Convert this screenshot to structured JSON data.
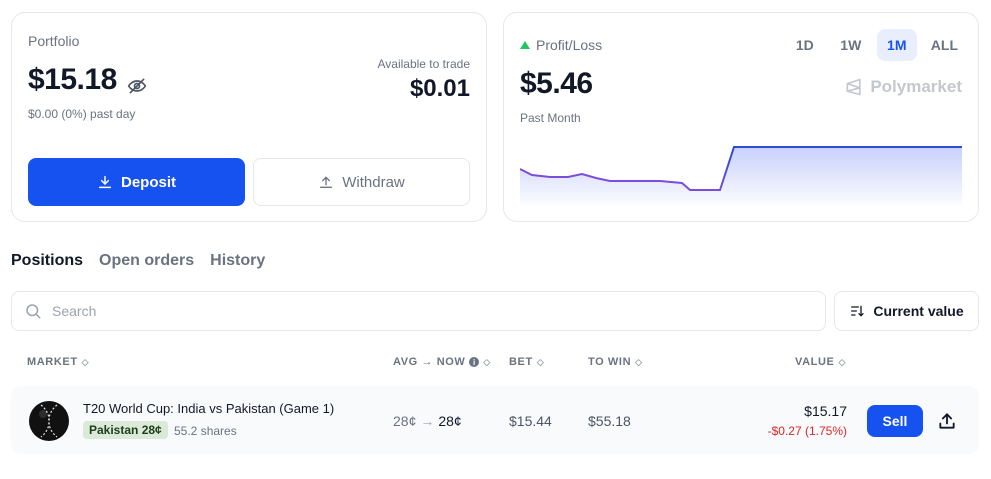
{
  "portfolio": {
    "label": "Portfolio",
    "balance": "$15.18",
    "day_change": "$0.00 (0%) past day",
    "available_label": "Available to trade",
    "available_value": "$0.01",
    "deposit_label": "Deposit",
    "withdraw_label": "Withdraw"
  },
  "pnl": {
    "label": "Profit/Loss",
    "value": "$5.46",
    "period": "Past Month",
    "brand": "Polymarket",
    "ranges": [
      {
        "label": "1D",
        "active": false
      },
      {
        "label": "1W",
        "active": false
      },
      {
        "label": "1M",
        "active": true
      },
      {
        "label": "ALL",
        "active": false
      }
    ],
    "accent_color": "#1652f0",
    "line_color_down": "#7c4ddb"
  },
  "tabs": [
    {
      "label": "Positions",
      "active": true
    },
    {
      "label": "Open orders",
      "active": false
    },
    {
      "label": "History",
      "active": false
    }
  ],
  "search": {
    "placeholder": "Search"
  },
  "sort": {
    "label": "Current value"
  },
  "table": {
    "headers": {
      "market": "MARKET",
      "avg_now": "AVG → NOW",
      "bet": "BET",
      "to_win": "TO WIN",
      "value": "VALUE"
    },
    "rows": [
      {
        "title": "T20 World Cup: India vs Pakistan (Game 1)",
        "outcome": "Pakistan 28¢",
        "shares": "55.2 shares",
        "avg": "28¢",
        "arrow": "→",
        "now": "28¢",
        "bet": "$15.44",
        "to_win": "$55.18",
        "value": "$15.17",
        "value_change": "-$0.27 (1.75%)",
        "sell_label": "Sell"
      }
    ]
  }
}
